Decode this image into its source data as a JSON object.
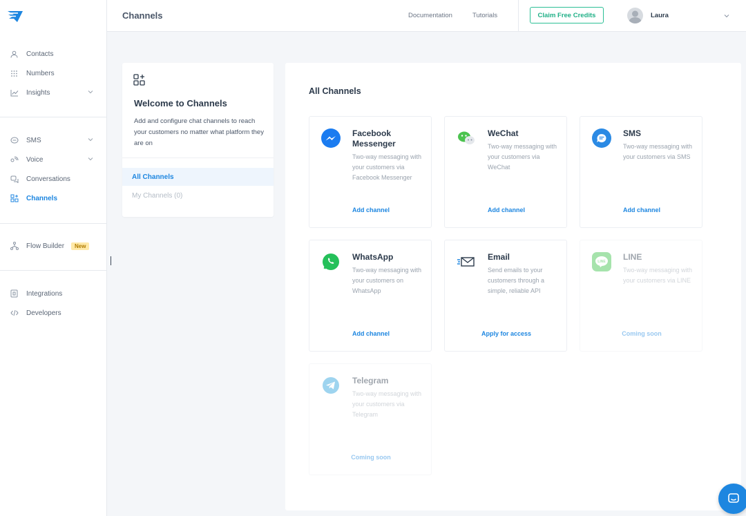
{
  "topbar": {
    "title": "Channels",
    "documentation": "Documentation",
    "tutorials": "Tutorials",
    "claim_credits": "Claim Free Credits",
    "user_name": "Laura"
  },
  "sidebar": {
    "group1": [
      {
        "label": "Contacts",
        "icon": "person-icon"
      },
      {
        "label": "Numbers",
        "icon": "grid-dots-icon"
      },
      {
        "label": "Insights",
        "icon": "line-chart-icon"
      }
    ],
    "group2": [
      {
        "label": "SMS",
        "icon": "message-icon"
      },
      {
        "label": "Voice",
        "icon": "voice-icon"
      },
      {
        "label": "Conversations",
        "icon": "conversations-icon"
      },
      {
        "label": "Channels",
        "icon": "channels-icon"
      }
    ],
    "group3": [
      {
        "label": "Flow Builder",
        "icon": "flow-icon",
        "badge": "New"
      }
    ],
    "group4": [
      {
        "label": "Integrations",
        "icon": "integrations-icon"
      },
      {
        "label": "Developers",
        "icon": "code-icon"
      }
    ]
  },
  "welcome": {
    "title": "Welcome to Channels",
    "description": "Add and configure chat channels to reach your customers no matter what platform they are on",
    "tab_all": "All Channels",
    "tab_mine": "My Channels (0)"
  },
  "main": {
    "title": "All Channels",
    "cards": [
      {
        "name": "Facebook Messenger",
        "desc": "Two-way messaging with your customers via Facebook Messenger",
        "action": "Add channel"
      },
      {
        "name": "WeChat",
        "desc": "Two-way messaging with your customers via WeChat",
        "action": "Add channel"
      },
      {
        "name": "SMS",
        "desc": "Two-way messaging with your customers via SMS",
        "action": "Add channel"
      },
      {
        "name": "WhatsApp",
        "desc": "Two-way messaging with your customers on WhatsApp",
        "action": "Add channel"
      },
      {
        "name": "Email",
        "desc": "Send emails to your customers through a simple, reliable API",
        "action": "Apply for access"
      },
      {
        "name": "LINE",
        "desc": "Two-way messaging with your customers via LINE",
        "action": "Coming soon"
      },
      {
        "name": "Telegram",
        "desc": "Two-way messaging with your customers via Telegram",
        "action": "Coming soon"
      }
    ]
  },
  "colors": {
    "accent": "#1d86e0",
    "claim_border": "#2bbf95",
    "messenger": "#1b7cf0",
    "wechat": "#4cc34f",
    "sms": "#2b8ae4",
    "whatsapp": "#25c05a",
    "line": "#3cc24a",
    "telegram": "#2aa1dc"
  }
}
